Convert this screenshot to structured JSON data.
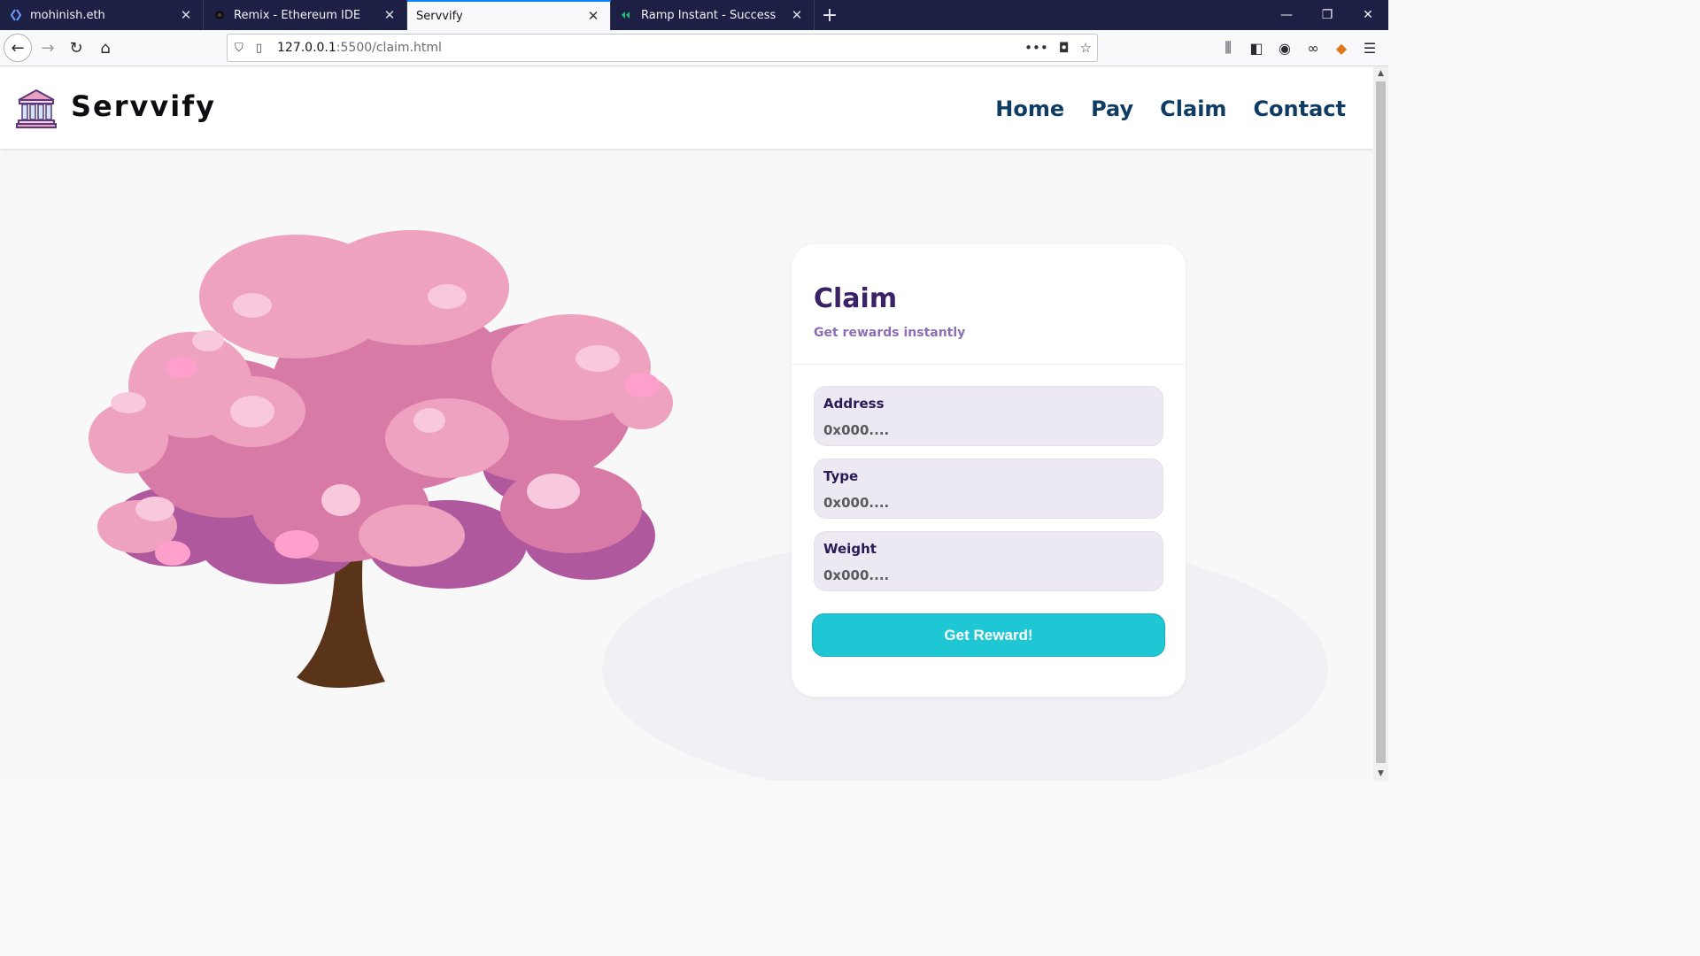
{
  "browser": {
    "tabs": [
      {
        "label": "mohinish.eth",
        "icon": "ens-icon"
      },
      {
        "label": "Remix - Ethereum IDE",
        "icon": "remix-icon"
      },
      {
        "label": "Servvify",
        "icon": "none"
      },
      {
        "label": "Ramp Instant - Success",
        "icon": "ramp-icon"
      }
    ],
    "active_tab": 2,
    "url_host": "127.0.0.1",
    "url_path": ":5500/claim.html",
    "accent": "#0a84ff"
  },
  "site": {
    "brand": "Servvify",
    "nav": [
      "Home",
      "Pay",
      "Claim",
      "Contact"
    ],
    "nav_color": "#0f3c63"
  },
  "claim_card": {
    "title": "Claim",
    "subtitle": "Get rewards instantly",
    "fields": [
      {
        "label": "Address",
        "placeholder": "0x000...."
      },
      {
        "label": "Type",
        "placeholder": "0x000...."
      },
      {
        "label": "Weight",
        "placeholder": "0x000...."
      }
    ],
    "button_label": "Get Reward!",
    "button_color": "#1fc6d3"
  }
}
